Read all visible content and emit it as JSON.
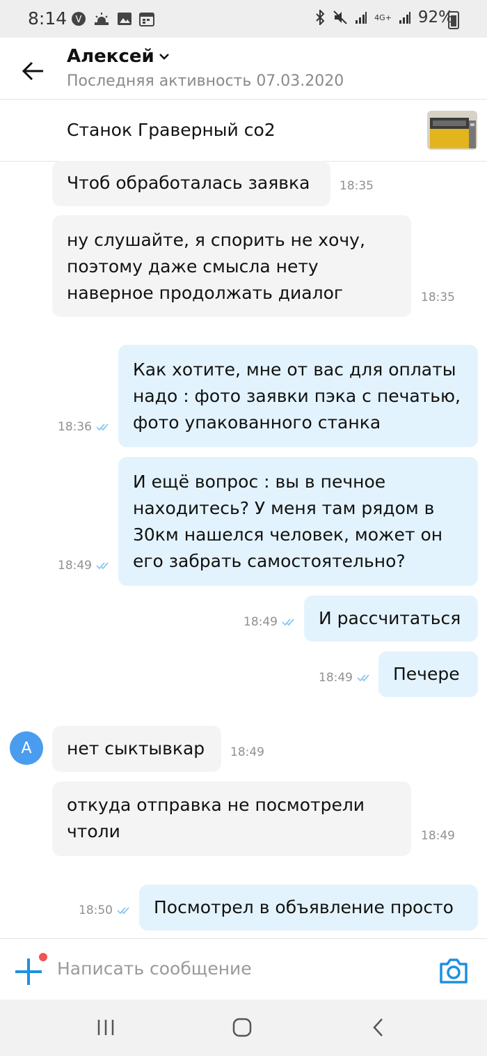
{
  "status_bar": {
    "time": "8:14",
    "battery": "92%",
    "network": "4G+"
  },
  "header": {
    "name": "Алексей",
    "last_active": "Последняя активность 07.03.2020"
  },
  "listing": {
    "title": "Станок Граверный со2"
  },
  "messages": [
    {
      "dir": "in",
      "lines": [
        "Чтоб обработалась заявка"
      ],
      "time": "18:35"
    },
    {
      "dir": "in",
      "lines": [
        "ну слушайте, я спорить не хочу,",
        "поэтому даже смысла нету",
        "наверное продолжать диалог"
      ],
      "time": "18:35"
    },
    {
      "dir": "out",
      "lines": [
        "Как хотите, мне от вас для оплаты",
        "надо : фото заявки пэка с печатью,",
        "фото упакованного станка"
      ],
      "time": "18:36"
    },
    {
      "dir": "out",
      "lines": [
        "И ещё вопрос : вы в печное",
        "находитесь? У меня там рядом в",
        "30км нашелся человек, может он",
        "его забрать самостоятельно?"
      ],
      "time": "18:49"
    },
    {
      "dir": "out",
      "lines": [
        "И рассчитаться"
      ],
      "time": "18:49"
    },
    {
      "dir": "out",
      "lines": [
        "Печере"
      ],
      "time": "18:49"
    },
    {
      "dir": "in",
      "lines": [
        "нет сыктывкар"
      ],
      "time": "18:49"
    },
    {
      "dir": "in",
      "lines": [
        "откуда отправка не посмотрели",
        "чтоли"
      ],
      "time": "18:49"
    },
    {
      "dir": "out",
      "lines": [
        "Посмотрел в объявление просто"
      ],
      "time": "18:50"
    }
  ],
  "avatar_letter": "А",
  "input": {
    "placeholder": "Написать сообщение"
  },
  "colors": {
    "incoming_bubble": "#f4f4f4",
    "outgoing_bubble": "#e3f3fd",
    "accent": "#1e8fe1",
    "avatar": "#4a9cef",
    "notification_dot": "#f05454"
  }
}
